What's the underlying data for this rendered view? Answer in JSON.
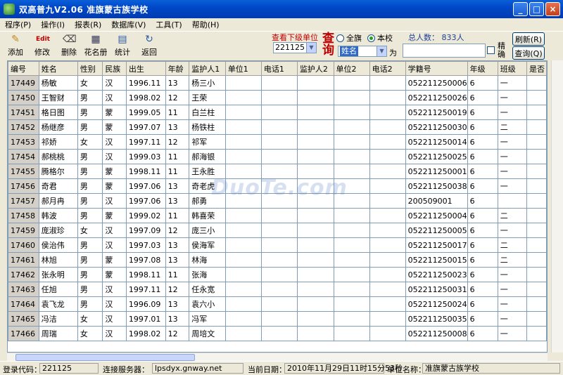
{
  "window": {
    "title": "双高普九V2.06  准旗蒙古族学校"
  },
  "menu": [
    "程序(P)",
    "操作(I)",
    "报表(R)",
    "数据库(V)",
    "工具(T)",
    "帮助(H)"
  ],
  "toolbar": {
    "add": "添加",
    "edit": "修改",
    "delete": "删除",
    "roster": "花名册",
    "stats": "统计",
    "back": "返回"
  },
  "query": {
    "sub_unit_label": "查看下级单位",
    "unit_value": "221125",
    "big_label": "查询",
    "radio_all": "全旗",
    "radio_school": "本校",
    "field_value": "姓名",
    "wei": "为",
    "total_label": "总人数： 833人",
    "exact_label": "精确",
    "refresh_btn": "刷新(R)",
    "search_btn": "查询(Q)"
  },
  "table": {
    "columns": [
      "编号",
      "姓名",
      "性别",
      "民族",
      "出生",
      "年龄",
      "监护人1",
      "单位1",
      "电话1",
      "监护人2",
      "单位2",
      "电话2",
      "学籍号",
      "年级",
      "班级",
      "是否"
    ],
    "rows": [
      [
        "17449",
        "杨敏",
        "女",
        "汉",
        "1996.11",
        "13",
        "杨三小",
        "",
        "",
        "",
        "",
        "",
        "052211250006",
        "6",
        "一",
        ""
      ],
      [
        "17450",
        "王智财",
        "男",
        "汉",
        "1998.02",
        "12",
        "王荣",
        "",
        "",
        "",
        "",
        "",
        "052211250026",
        "6",
        "一",
        ""
      ],
      [
        "17451",
        "格日图",
        "男",
        "蒙",
        "1999.05",
        "11",
        "白兰柱",
        "",
        "",
        "",
        "",
        "",
        "052211250019",
        "6",
        "一",
        ""
      ],
      [
        "17452",
        "杨继彦",
        "男",
        "蒙",
        "1997.07",
        "13",
        "杨铁柱",
        "",
        "",
        "",
        "",
        "",
        "052211250030",
        "6",
        "二",
        ""
      ],
      [
        "17453",
        "祁娇",
        "女",
        "汉",
        "1997.11",
        "12",
        "祁军",
        "",
        "",
        "",
        "",
        "",
        "052211250014",
        "6",
        "一",
        ""
      ],
      [
        "17454",
        "郝桃桃",
        "男",
        "汉",
        "1999.03",
        "11",
        "郝海银",
        "",
        "",
        "",
        "",
        "",
        "052211250025",
        "6",
        "一",
        ""
      ],
      [
        "17455",
        "腾格尔",
        "男",
        "蒙",
        "1998.11",
        "11",
        "王永胜",
        "",
        "",
        "",
        "",
        "",
        "052211250001",
        "6",
        "一",
        ""
      ],
      [
        "17456",
        "奇君",
        "男",
        "蒙",
        "1997.06",
        "13",
        "奇老虎",
        "",
        "",
        "",
        "",
        "",
        "052211250038",
        "6",
        "一",
        ""
      ],
      [
        "17457",
        "郝月冉",
        "男",
        "汉",
        "1997.06",
        "13",
        "郝勇",
        "",
        "",
        "",
        "",
        "",
        "200509001",
        "6",
        "",
        ""
      ],
      [
        "17458",
        "韩波",
        "男",
        "蒙",
        "1999.02",
        "11",
        "韩喜荣",
        "",
        "",
        "",
        "",
        "",
        "052211250004",
        "6",
        "二",
        ""
      ],
      [
        "17459",
        "庞淑珍",
        "女",
        "汉",
        "1997.09",
        "12",
        "庞三小",
        "",
        "",
        "",
        "",
        "",
        "052211250005",
        "6",
        "一",
        ""
      ],
      [
        "17460",
        "侯治伟",
        "男",
        "汉",
        "1997.03",
        "13",
        "侯海军",
        "",
        "",
        "",
        "",
        "",
        "052211250017",
        "6",
        "二",
        ""
      ],
      [
        "17461",
        "林旭",
        "男",
        "蒙",
        "1997.08",
        "13",
        "林海",
        "",
        "",
        "",
        "",
        "",
        "052211250015",
        "6",
        "二",
        ""
      ],
      [
        "17462",
        "张永明",
        "男",
        "蒙",
        "1998.11",
        "11",
        "张海",
        "",
        "",
        "",
        "",
        "",
        "052211250023",
        "6",
        "一",
        ""
      ],
      [
        "17463",
        "任旭",
        "男",
        "汉",
        "1997.11",
        "12",
        "任永宽",
        "",
        "",
        "",
        "",
        "",
        "052211250031",
        "6",
        "一",
        ""
      ],
      [
        "17464",
        "袁飞龙",
        "男",
        "汉",
        "1996.09",
        "13",
        "袁六小",
        "",
        "",
        "",
        "",
        "",
        "052211250024",
        "6",
        "一",
        ""
      ],
      [
        "17465",
        "冯洁",
        "女",
        "汉",
        "1997.01",
        "13",
        "冯军",
        "",
        "",
        "",
        "",
        "",
        "052211250035",
        "6",
        "一",
        ""
      ],
      [
        "17466",
        "周瑞",
        "女",
        "汉",
        "1998.02",
        "12",
        "周培文",
        "",
        "",
        "",
        "",
        "",
        "052211250008",
        "6",
        "一",
        ""
      ]
    ]
  },
  "status": {
    "login_label": "登录代码：",
    "login_value": "221125",
    "server_label": "连接服务器：",
    "server_value": "lpsdyx.gnway.net",
    "date_label": "当前日期：",
    "date_value": "2010年11月29日11时15分53秒",
    "unit_label": "单位名称：",
    "unit_value": "准旗蒙古族学校"
  },
  "watermark": "DuoTe.com"
}
